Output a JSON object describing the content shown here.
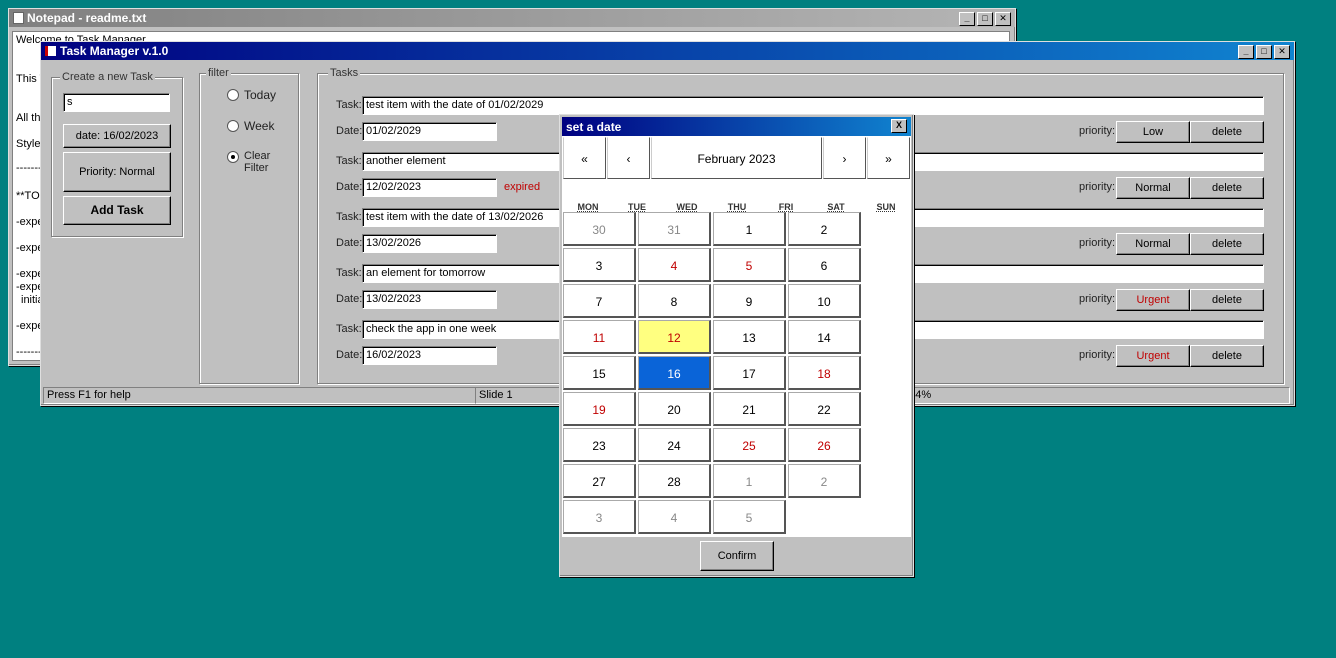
{
  "notepad": {
    "title": "Notepad - readme.txt",
    "lines": [
      "Welcome to Task Manager",
      "This T",
      "All th",
      "Style",
      "-------",
      "**TOD",
      "-expe",
      "-expe",
      "-expe",
      "-expe",
      "initia",
      "-expe",
      "-------"
    ]
  },
  "taskmanager": {
    "title": "Task Manager v.1.0",
    "create": {
      "legend": "Create a new Task",
      "input_value": "s",
      "date_button": "date: 16/02/2023",
      "priority_button": "Priority: Normal",
      "add_button": "Add Task"
    },
    "filter": {
      "legend": "filter",
      "options": [
        "Today",
        "Week",
        "Clear Filter"
      ],
      "selected_index": 2
    },
    "tasks_legend": "Tasks",
    "task_label": "Task:",
    "date_label": "Date:",
    "priority_label": "priority:",
    "delete_label": "delete",
    "expired_label": "expired",
    "tasks": [
      {
        "task": "test item with the date of 01/02/2029",
        "date": "01/02/2029",
        "priority": "Low",
        "expired": false
      },
      {
        "task": "another element",
        "date": "12/02/2023",
        "priority": "Normal",
        "expired": true
      },
      {
        "task": "test item with the date of 13/02/2026",
        "date": "13/02/2026",
        "priority": "Normal",
        "expired": false
      },
      {
        "task": "an element for tomorrow",
        "date": "13/02/2023",
        "priority": "Urgent",
        "expired": false
      },
      {
        "task": "check the app in one week",
        "date": "16/02/2023",
        "priority": "Urgent",
        "expired": false
      }
    ],
    "status": {
      "help": "Press F1 for help",
      "slide": "Slide 1",
      "zoom": ": 14%"
    }
  },
  "datepicker": {
    "title": "set a date",
    "close": "X",
    "month_label": "February 2023",
    "nav": {
      "prev_year": "«",
      "prev_month": "‹",
      "next_month": "›",
      "next_year": "»"
    },
    "weekdays": [
      "MON",
      "TUE",
      "WED",
      "THU",
      "FRI",
      "SAT",
      "SUN"
    ],
    "days": [
      [
        "30",
        "31",
        "1",
        "2"
      ],
      [
        "3",
        "4",
        "5",
        "6"
      ],
      [
        "7",
        "8",
        "9",
        "10"
      ],
      [
        "11",
        "12",
        "13",
        "14"
      ],
      [
        "15",
        "16",
        "17",
        "18"
      ],
      [
        "19",
        "20",
        "21",
        "22"
      ],
      [
        "23",
        "24",
        "25",
        "26"
      ],
      [
        "27",
        "28",
        "1",
        "2"
      ],
      [
        "3",
        "4",
        "5"
      ]
    ],
    "confirm": "Confirm",
    "colors": {
      "weekend_red": "#c00000",
      "today": "#ffff80",
      "selected": "#0a64d8"
    }
  }
}
